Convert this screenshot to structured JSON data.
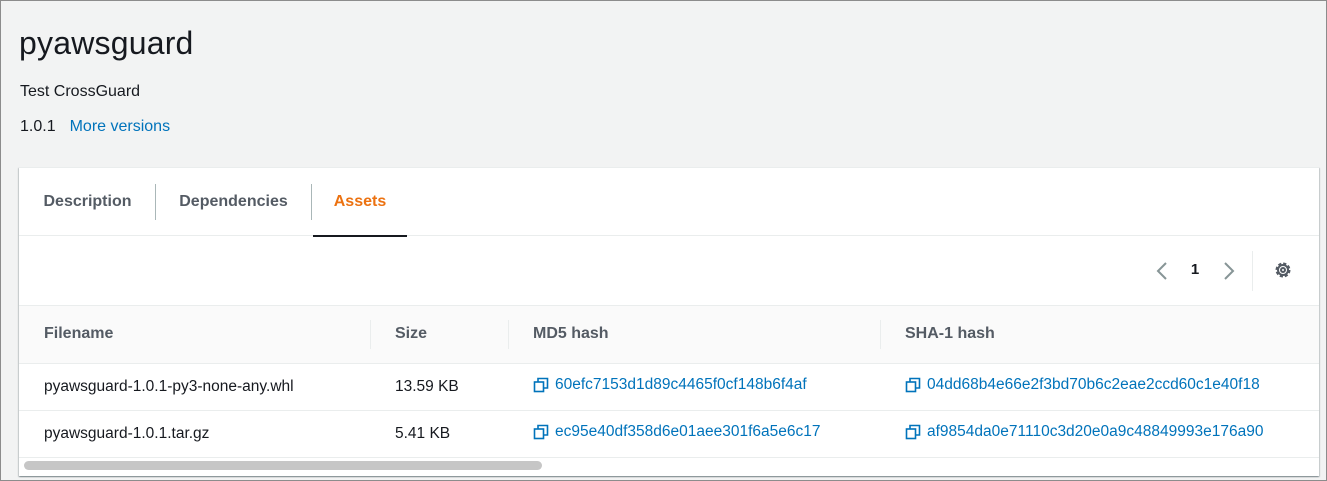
{
  "package": {
    "name": "pyawsguard",
    "description": "Test CrossGuard",
    "version": "1.0.1",
    "more_versions_label": "More versions"
  },
  "tabs": [
    {
      "label": "Description",
      "active": false
    },
    {
      "label": "Dependencies",
      "active": false
    },
    {
      "label": "Assets",
      "active": true
    }
  ],
  "pagination": {
    "current_page": "1",
    "prev_icon": "chevron-left-icon",
    "next_icon": "chevron-right-icon",
    "settings_icon": "gear-icon"
  },
  "table": {
    "columns": [
      "Filename",
      "Size",
      "MD5 hash",
      "SHA-1 hash"
    ],
    "rows": [
      {
        "filename": "pyawsguard-1.0.1-py3-none-any.whl",
        "size": "13.59 KB",
        "md5": "60efc7153d1d89c4465f0cf148b6f4af",
        "sha1": "04dd68b4e66e2f3bd70b6c2eae2ccd60c1e40f18"
      },
      {
        "filename": "pyawsguard-1.0.1.tar.gz",
        "size": "5.41 KB",
        "md5": "ec95e40df358d6e01aee301f6a5e6c17",
        "sha1": "af9854da0e71110c3d20e0a9c48849993e176a90"
      }
    ]
  },
  "colors": {
    "link": "#0073bb",
    "active_tab": "#ec7211",
    "text": "#16191f",
    "muted": "#545b64",
    "page_bg": "#f2f3f3"
  }
}
